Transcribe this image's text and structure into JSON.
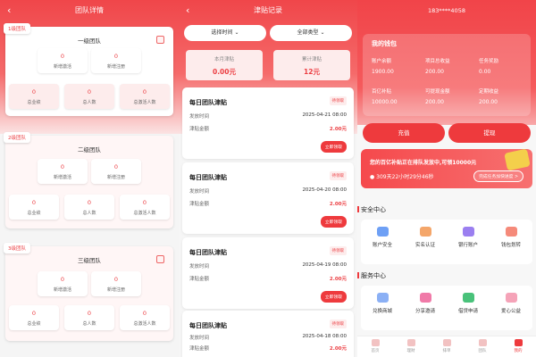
{
  "team": {
    "title": "团队详情",
    "tiers": [
      {
        "tag": "1级团队",
        "title": "一级团队",
        "stats": [
          {
            "value": "0",
            "label": "新增激活"
          },
          {
            "value": "0",
            "label": "新增注册"
          },
          {
            "value": "0",
            "label": "总业绩"
          },
          {
            "value": "0",
            "label": "总人数"
          },
          {
            "value": "0",
            "label": "总激活人数"
          }
        ]
      },
      {
        "tag": "2级团队",
        "title": "二级团队",
        "stats": [
          {
            "value": "0",
            "label": "新增激活"
          },
          {
            "value": "0",
            "label": "新增注册"
          },
          {
            "value": "0",
            "label": "总业绩"
          },
          {
            "value": "0",
            "label": "总人数"
          },
          {
            "value": "0",
            "label": "总激活人数"
          }
        ]
      },
      {
        "tag": "3级团队",
        "title": "三级团队",
        "stats": [
          {
            "value": "0",
            "label": "新增激活"
          },
          {
            "value": "0",
            "label": "新增注册"
          },
          {
            "value": "0",
            "label": "总业绩"
          },
          {
            "value": "0",
            "label": "总人数"
          },
          {
            "value": "0",
            "label": "总激活人数"
          }
        ]
      }
    ]
  },
  "subsidy": {
    "title": "津贴记录",
    "filter_time": "选择时间",
    "filter_type": "全部类型",
    "month_label": "本月津贴",
    "month_value": "0.00元",
    "total_label": "累计津贴",
    "total_value": "12元",
    "records": [
      {
        "title": "每日团队津贴",
        "status": "待领取",
        "time_label": "发放时间",
        "time": "2025-04-21 08:00",
        "amount_label": "津贴金额",
        "amount": "2.00元",
        "claim": "立即领取"
      },
      {
        "title": "每日团队津贴",
        "status": "待领取",
        "time_label": "发放时间",
        "time": "2025-04-20 08:00",
        "amount_label": "津贴金额",
        "amount": "2.00元",
        "claim": "立即领取"
      },
      {
        "title": "每日团队津贴",
        "status": "待领取",
        "time_label": "发放时间",
        "time": "2025-04-19 08:00",
        "amount_label": "津贴金额",
        "amount": "2.00元",
        "claim": "立即领取"
      },
      {
        "title": "每日团队津贴",
        "status": "待领取",
        "time_label": "发放时间",
        "time": "2025-04-18 08:00",
        "amount_label": "津贴金额",
        "amount": "2.00元",
        "claim": "立即领取"
      }
    ]
  },
  "profile": {
    "phone": "183****4058",
    "wallet_title": "我的钱包",
    "wallet": [
      {
        "label": "账户余额",
        "value": "1900.00"
      },
      {
        "label": "项目总收益",
        "value": "200.00"
      },
      {
        "label": "任务奖励",
        "value": "0.00"
      },
      {
        "label": "百亿补贴",
        "value": "10000.00"
      },
      {
        "label": "可提现金额",
        "value": "200.00"
      },
      {
        "label": "定期收益",
        "value": "200.00"
      }
    ],
    "recharge": "充值",
    "withdraw": "提现",
    "notice_text": "您的百亿补贴正在排队发放中,可领10000元",
    "countdown": "309天22小时29分46秒",
    "notice_button": "完成任务加快进度 >",
    "security_title": "安全中心",
    "security": [
      {
        "label": "账户安全",
        "icon": "shield-icon",
        "color": "#6ea0f5"
      },
      {
        "label": "实名认证",
        "icon": "idcard-icon",
        "color": "#f4a66a"
      },
      {
        "label": "银行账户",
        "icon": "bank-icon",
        "color": "#9b7ff0"
      },
      {
        "label": "钱包划转",
        "icon": "transfer-icon",
        "color": "#f58a7a"
      }
    ],
    "service_title": "服务中心",
    "service": [
      {
        "label": "兑换商城",
        "icon": "shop-icon",
        "color": "#8bb0f5"
      },
      {
        "label": "分享邀请",
        "icon": "share-icon",
        "color": "#f07aa8"
      },
      {
        "label": "借贷申请",
        "icon": "loan-icon",
        "color": "#49c27a"
      },
      {
        "label": "爱心公益",
        "icon": "heart-icon",
        "color": "#f5a3b8"
      }
    ],
    "tabs": [
      {
        "label": "首页"
      },
      {
        "label": "理财"
      },
      {
        "label": "排单"
      },
      {
        "label": "团队"
      },
      {
        "label": "我的"
      }
    ]
  }
}
